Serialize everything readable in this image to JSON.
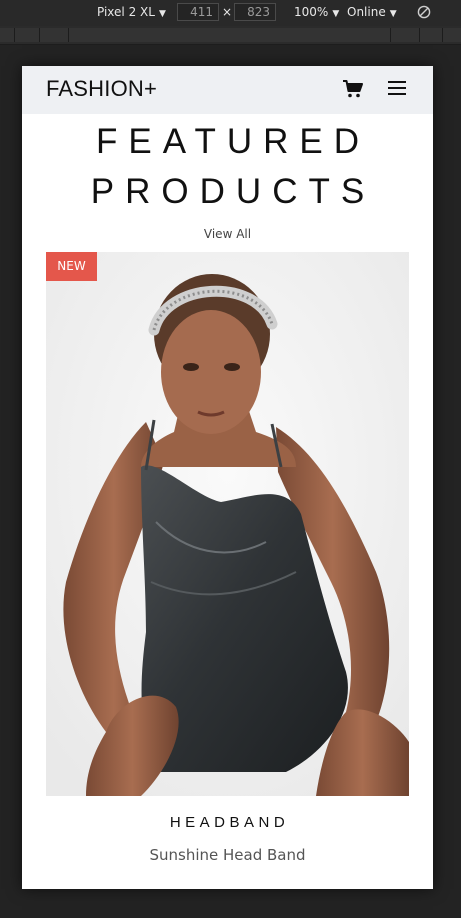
{
  "devtools": {
    "device": "Pixel 2 XL",
    "width": "411",
    "times": "×",
    "height": "823",
    "zoom": "100%",
    "network": "Online"
  },
  "navbar": {
    "brand": "FASHION+"
  },
  "section": {
    "title_line1": "FEATURED",
    "title_line2": "PRODUCTS",
    "view_all": "View All"
  },
  "product": {
    "badge": "NEW",
    "category": "HEADBAND",
    "name": "Sunshine Head Band"
  },
  "colors": {
    "badge_bg": "#e4574b",
    "navbar_bg": "#eef0f3",
    "devtools_bg": "#292929"
  }
}
